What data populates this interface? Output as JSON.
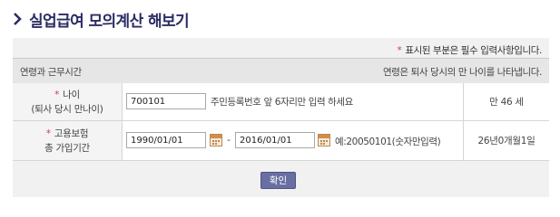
{
  "title": "실업급여 모의계산 해보기",
  "required_note": "표시된 부분은 필수 입력사항입니다.",
  "required_star": "*",
  "section": {
    "left": "연령과 근무시간",
    "right": "연령은 퇴사 당시의 만 나이를 나타냅니다."
  },
  "age_row": {
    "label_line1": "나이",
    "label_line2": "(퇴사 당시 만나이)",
    "input_value": "700101",
    "hint": "주민등록번호 앞 6자리만 입력 하세요",
    "result": "만 46 세"
  },
  "period_row": {
    "label_line1": "고용보험",
    "label_line2": "총 가입기간",
    "start_value": "1990/01/01",
    "separator": "-",
    "end_value": "2016/01/01",
    "hint": "예:20050101(숫자만입력)",
    "result": "26년0개월1일"
  },
  "confirm_label": "확인",
  "icons": {
    "title_marker": "chevron-right-icon",
    "date_picker": "calendar-icon"
  },
  "colors": {
    "title": "#2b2c63",
    "required_star": "#d73a4a",
    "confirm_button": "#6a6fa2"
  }
}
